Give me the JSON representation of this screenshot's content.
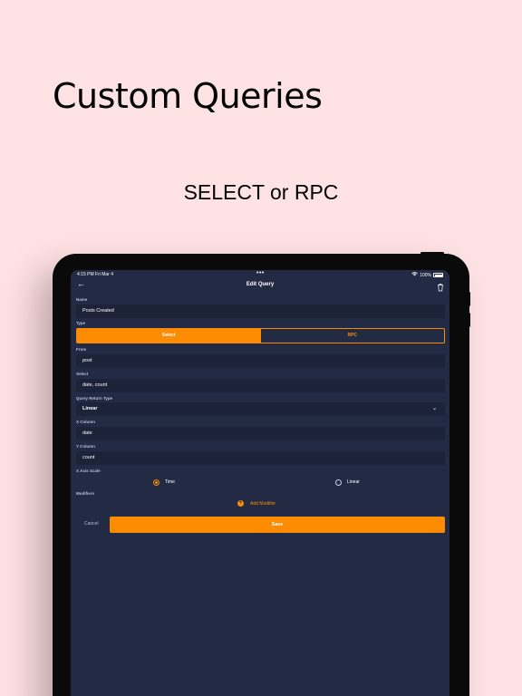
{
  "promo": {
    "headline": "Custom Queries",
    "subline": "SELECT or RPC"
  },
  "status_bar": {
    "time": "4:15 PM  Fri Mar 4",
    "dots": "•••",
    "battery_percent": "100%"
  },
  "nav": {
    "back_icon": "arrow-left-icon",
    "title": "Edit Query",
    "trash_icon": "trash-icon"
  },
  "form": {
    "name_label": "Name",
    "name_value": "Posts Created",
    "type_label": "Type",
    "type_options": [
      "Select",
      "RPC"
    ],
    "type_selected": "Select",
    "from_label": "From",
    "from_value": "post",
    "select_label": "Select",
    "select_value": "date, count",
    "return_type_label": "Query Return Type",
    "return_type_value": "Linear",
    "x_column_label": "X Column",
    "x_column_value": "date",
    "y_column_label": "Y Column",
    "y_column_value": "count",
    "x_axis_scale_label": "X Axis Scale",
    "x_axis_scale_options": [
      "Time",
      "Linear"
    ],
    "x_axis_scale_selected": "Time",
    "modifiers_label": "Modifiers",
    "add_modifier": "Add Modifier",
    "cancel": "Cancel",
    "save": "Save"
  },
  "colors": {
    "accent": "#ff8c00",
    "background": "#222a44",
    "field": "#1c2339",
    "page": "#ffe2e4"
  }
}
